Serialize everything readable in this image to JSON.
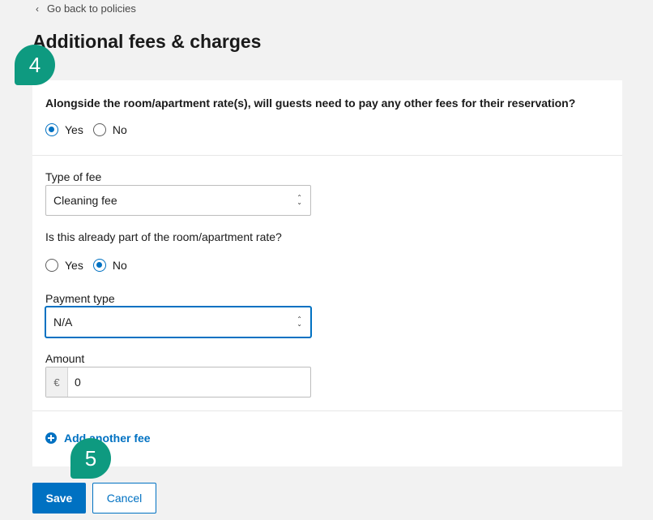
{
  "nav": {
    "back_label": "Go back to policies"
  },
  "page": {
    "title": "Additional fees & charges"
  },
  "question": {
    "text": "Alongside the room/apartment rate(s), will guests need to pay any other fees for their reservation?",
    "options": [
      {
        "label": "Yes",
        "checked": true
      },
      {
        "label": "No",
        "checked": false
      }
    ]
  },
  "fee": {
    "type_label": "Type of fee",
    "type_value": "Cleaning fee",
    "included_label": "Is this already part of the room/apartment rate?",
    "included_options": [
      {
        "label": "Yes",
        "checked": false
      },
      {
        "label": "No",
        "checked": true
      }
    ],
    "payment_label": "Payment type",
    "payment_value": "N/A",
    "amount_label": "Amount",
    "currency_symbol": "€",
    "amount_value": "0"
  },
  "actions": {
    "add_fee_label": "Add another fee",
    "save_label": "Save",
    "cancel_label": "Cancel"
  },
  "markers": [
    "4",
    "5"
  ],
  "colors": {
    "accent": "#0071c2",
    "marker": "#0e9a80"
  }
}
